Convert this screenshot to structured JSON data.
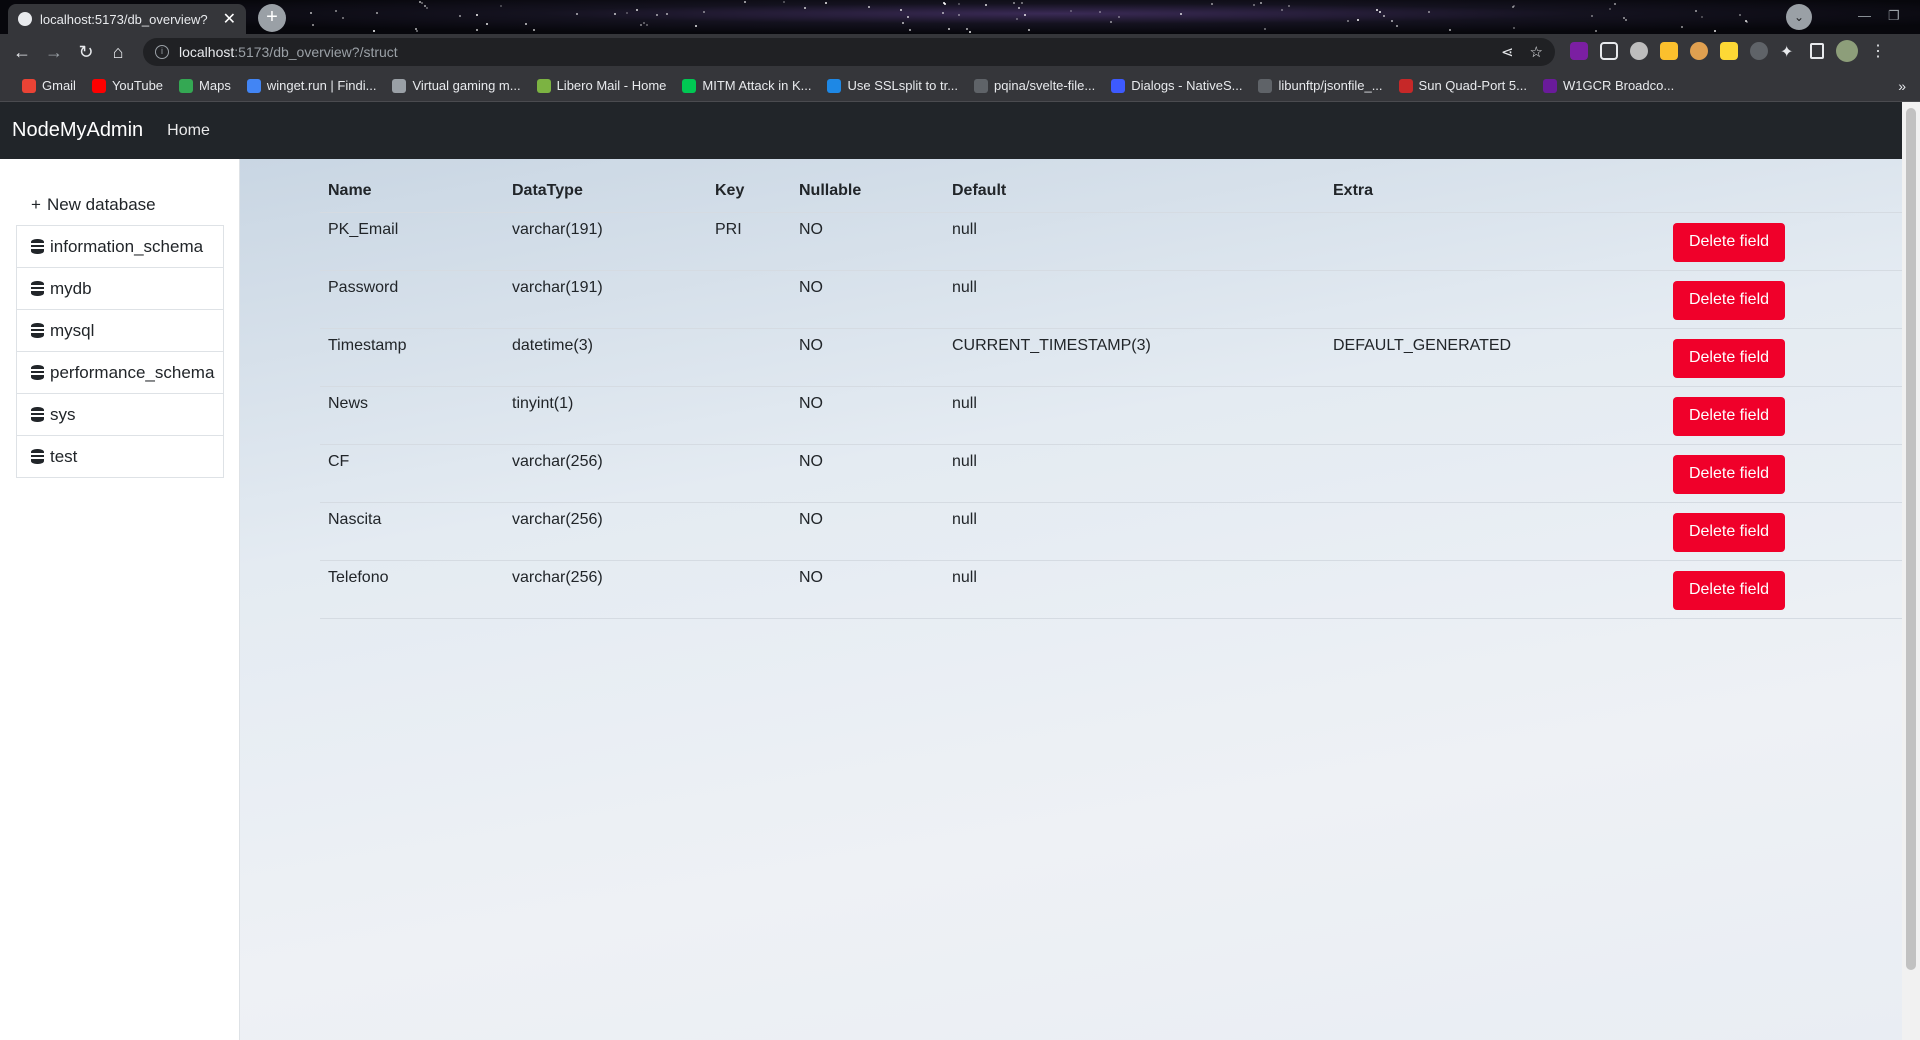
{
  "browser": {
    "tab_title": "localhost:5173/db_overview?",
    "url_host": "localhost",
    "url_path": ":5173/db_overview?/struct",
    "bookmarks": [
      {
        "label": "Gmail",
        "color": "#ea4335"
      },
      {
        "label": "YouTube",
        "color": "#ff0000"
      },
      {
        "label": "Maps",
        "color": "#34a853"
      },
      {
        "label": "winget.run | Findi...",
        "color": "#4285f4"
      },
      {
        "label": "Virtual gaming m...",
        "color": "#9aa0a6"
      },
      {
        "label": "Libero Mail - Home",
        "color": "#7cb342"
      },
      {
        "label": "MITM Attack in K...",
        "color": "#00c853"
      },
      {
        "label": "Use SSLsplit to tr...",
        "color": "#1e88e5"
      },
      {
        "label": "pqina/svelte-file...",
        "color": "#5f6368"
      },
      {
        "label": "Dialogs - NativeS...",
        "color": "#3d5afe"
      },
      {
        "label": "libunftp/jsonfile_...",
        "color": "#5f6368"
      },
      {
        "label": "Sun Quad-Port 5...",
        "color": "#c62828"
      },
      {
        "label": "W1GCR Broadco...",
        "color": "#6a1b9a"
      }
    ]
  },
  "app": {
    "brand": "NodeMyAdmin",
    "nav_home": "Home"
  },
  "sidebar": {
    "new_database": "New database",
    "databases": [
      "information_schema",
      "mydb",
      "mysql",
      "performance_schema",
      "sys",
      "test"
    ]
  },
  "table": {
    "headers": [
      "Name",
      "DataType",
      "Key",
      "Nullable",
      "Default",
      "Extra"
    ],
    "delete_label": "Delete field",
    "rows": [
      {
        "name": "PK_Email",
        "type": "varchar(191)",
        "key": "PRI",
        "nullable": "NO",
        "default": "null",
        "extra": ""
      },
      {
        "name": "Password",
        "type": "varchar(191)",
        "key": "",
        "nullable": "NO",
        "default": "null",
        "extra": ""
      },
      {
        "name": "Timestamp",
        "type": "datetime(3)",
        "key": "",
        "nullable": "NO",
        "default": "CURRENT_TIMESTAMP(3)",
        "extra": "DEFAULT_GENERATED"
      },
      {
        "name": "News",
        "type": "tinyint(1)",
        "key": "",
        "nullable": "NO",
        "default": "null",
        "extra": ""
      },
      {
        "name": "CF",
        "type": "varchar(256)",
        "key": "",
        "nullable": "NO",
        "default": "null",
        "extra": ""
      },
      {
        "name": "Nascita",
        "type": "varchar(256)",
        "key": "",
        "nullable": "NO",
        "default": "null",
        "extra": ""
      },
      {
        "name": "Telefono",
        "type": "varchar(256)",
        "key": "",
        "nullable": "NO",
        "default": "null",
        "extra": ""
      }
    ]
  },
  "colors": {
    "navbar": "#212529",
    "delete_button": "#f0002a"
  }
}
